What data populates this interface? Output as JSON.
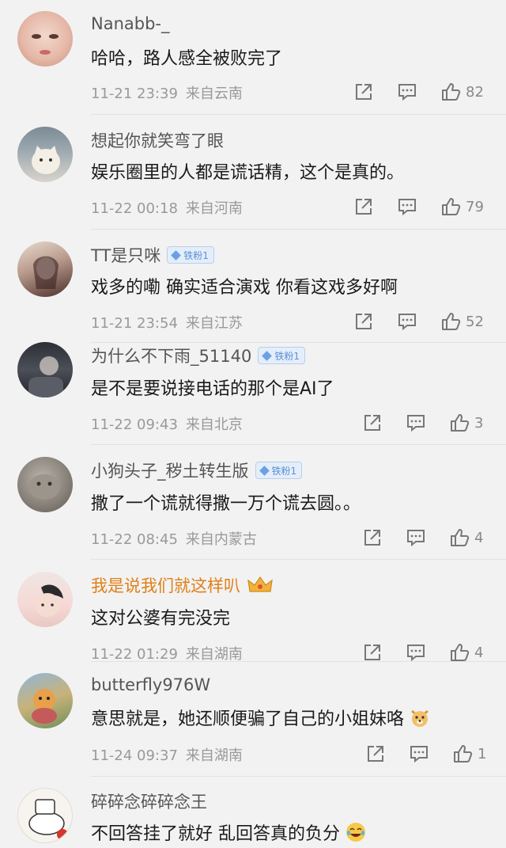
{
  "comments": [
    {
      "user": "Nanabb-_",
      "text": "哈哈，路人感全被败完了",
      "time": "11-21 23:39",
      "location": "来自云南",
      "likes": "82"
    },
    {
      "user": "想起你就笑弯了眼",
      "text": "娱乐圈里的人都是谎话精，这个是真的。",
      "time": "11-22 00:18",
      "location": "来自河南",
      "likes": "79"
    },
    {
      "user": "TT是只咪",
      "badge": "铁粉1",
      "text": "戏多的嘞 确实适合演戏 你看这戏多好啊",
      "time": "11-21 23:54",
      "location": "来自江苏",
      "likes": "52"
    },
    {
      "user": "为什么不下雨_51140",
      "badge": "铁粉1",
      "text": "是不是要说接电话的那个是AI了",
      "time": "11-22 09:43",
      "location": "来自北京",
      "likes": "3"
    },
    {
      "user": "小狗头子_秽土转生版",
      "badge": "铁粉1",
      "text": "撒了一个谎就得撒一万个谎去圆。。",
      "time": "11-22 08:45",
      "location": "来自内蒙古",
      "likes": "4"
    },
    {
      "user": "我是说我们就这样叭",
      "text": "这对公婆有完没完",
      "time": "11-22 01:29",
      "location": "来自湖南",
      "likes": "4"
    },
    {
      "user": "butterfly976W",
      "text": "意思就是，她还顺便骗了自己的小姐妹咯",
      "time": "11-24 09:37",
      "location": "来自湖南",
      "likes": "1"
    },
    {
      "user": "碎碎念碎碎念王",
      "text": "不回答挂了就好 乱回答真的负分"
    }
  ],
  "icons": {
    "share": "share-icon",
    "comment": "comment-icon",
    "like": "thumbs-up-icon"
  },
  "colors": {
    "vip_name": "#e0801a",
    "badge": "#5b8fd6",
    "text": "#1a1a1a",
    "meta": "#999999"
  }
}
